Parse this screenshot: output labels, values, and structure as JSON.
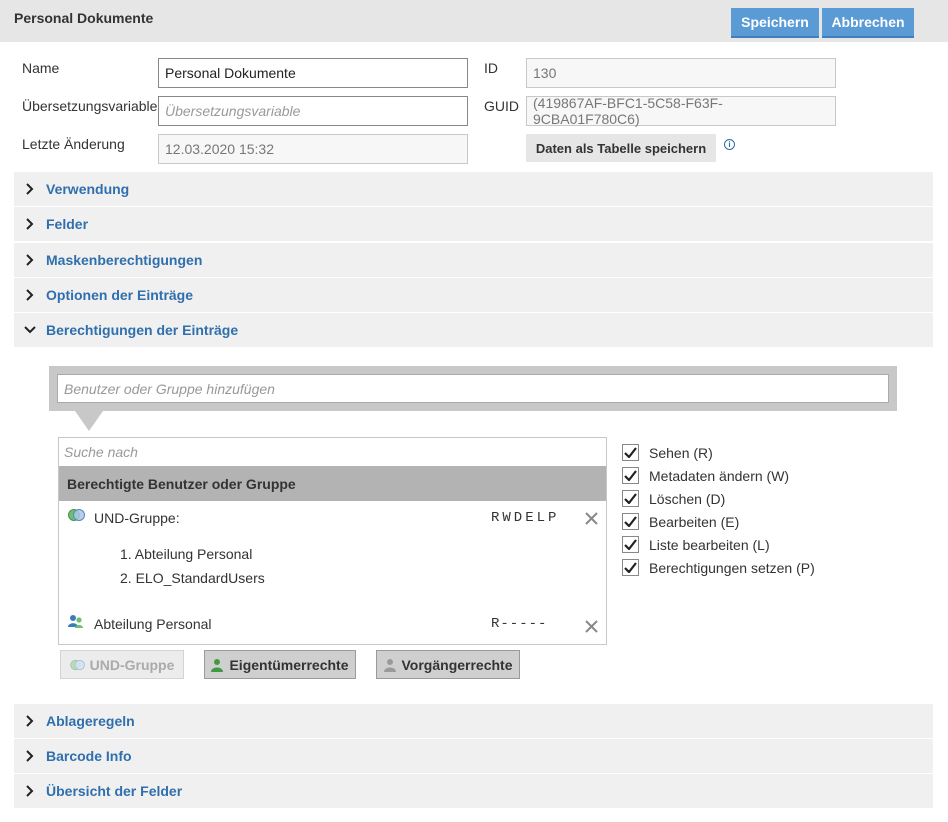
{
  "header": {
    "title": "Personal Dokumente",
    "save": "Speichern",
    "cancel": "Abbrechen"
  },
  "form": {
    "name_label": "Name",
    "name_value": "Personal Dokumente",
    "transvar_label": "Übersetzungsvariable",
    "transvar_placeholder": "Übersetzungsvariable",
    "lastchange_label": "Letzte Änderung",
    "lastchange_value": "12.03.2020 15:32",
    "id_label": "ID",
    "id_value": "130",
    "guid_label": "GUID",
    "guid_value": "(419867AF-BFC1-5C58-F63F-9CBA01F780C6)",
    "table_button": "Daten als Tabelle speichern",
    "info_glyph": "i"
  },
  "sections_top": [
    {
      "label": "Verwendung"
    },
    {
      "label": "Felder"
    },
    {
      "label": "Maskenberechtigungen"
    },
    {
      "label": "Optionen der Einträge"
    },
    {
      "label": "Berechtigungen der Einträge"
    }
  ],
  "permissions": {
    "add_placeholder": "Benutzer oder Gruppe hinzufügen",
    "search_placeholder": "Suche nach",
    "list_header": "Berechtigte Benutzer oder Gruppe",
    "entries": [
      {
        "name": "UND-Gruppe:",
        "rights": "RWDELP",
        "members": [
          "1. Abteilung Personal",
          "2. ELO_StandardUsers"
        ]
      },
      {
        "name": "Abteilung Personal",
        "rights": "R-----",
        "members": []
      }
    ],
    "checkboxes": [
      "Sehen (R)",
      "Metadaten ändern (W)",
      "Löschen (D)",
      "Bearbeiten (E)",
      "Liste bearbeiten (L)",
      "Berechtigungen setzen (P)"
    ],
    "buttons": {
      "und": "UND-Gruppe",
      "owner": "Eigentümerrechte",
      "pred": "Vorgängerrechte"
    }
  },
  "sections_bottom": [
    {
      "label": "Ablageregeln"
    },
    {
      "label": "Barcode Info"
    },
    {
      "label": "Übersicht der Felder"
    }
  ],
  "colors": {
    "accent": "#5a9bd5",
    "link": "#2f6fad",
    "section_bg": "#f0f0f0"
  }
}
